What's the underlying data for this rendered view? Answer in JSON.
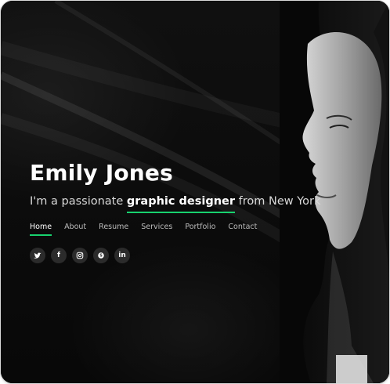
{
  "hero": {
    "name": "Emily Jones",
    "subtitle": {
      "before": "I'm a passionate ",
      "highlight": "graphic designer",
      "after": " from New York"
    }
  },
  "nav": {
    "items": [
      {
        "label": "Home",
        "active": true
      },
      {
        "label": "About",
        "active": false
      },
      {
        "label": "Resume",
        "active": false
      },
      {
        "label": "Services",
        "active": false
      },
      {
        "label": "Portfolio",
        "active": false
      },
      {
        "label": "Contact",
        "active": false
      }
    ]
  },
  "social": [
    {
      "icon": "twitter-icon",
      "glyph": ""
    },
    {
      "icon": "facebook-icon",
      "glyph": "f"
    },
    {
      "icon": "instagram-icon",
      "glyph": ""
    },
    {
      "icon": "skype-icon",
      "glyph": ""
    },
    {
      "icon": "linkedin-icon",
      "glyph": "in"
    }
  ],
  "colors": {
    "accent": "#18d26e",
    "background": "#0b0b0b",
    "text": "#ffffff"
  }
}
